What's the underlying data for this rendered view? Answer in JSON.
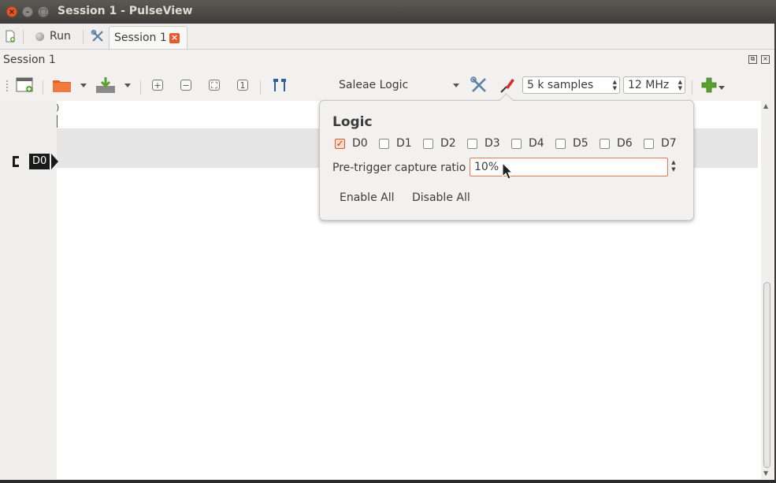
{
  "window": {
    "title": "Session 1 - PulseView"
  },
  "main_toolbar": {
    "run_label": "Run",
    "tab_label": "Session 1"
  },
  "session": {
    "title": "Session 1"
  },
  "device": {
    "name": "Saleae Logic",
    "samples": "5 k samples",
    "rate": "12 MHz"
  },
  "trace": {
    "label": "D0",
    "ruler_mark": ")"
  },
  "popup": {
    "title": "Logic",
    "channels": [
      {
        "label": "D0",
        "checked": true
      },
      {
        "label": "D1",
        "checked": false
      },
      {
        "label": "D2",
        "checked": false
      },
      {
        "label": "D3",
        "checked": false
      },
      {
        "label": "D4",
        "checked": false
      },
      {
        "label": "D5",
        "checked": false
      },
      {
        "label": "D6",
        "checked": false
      },
      {
        "label": "D7",
        "checked": false
      }
    ],
    "pretrigger_label": "Pre-trigger capture ratio",
    "pretrigger_value": "10%",
    "enable_all": "Enable All",
    "disable_all": "Disable All"
  },
  "colors": {
    "accent": "#e05a2c",
    "titlebar": "#3c3b37",
    "trace_label": "#1a1a1a"
  }
}
